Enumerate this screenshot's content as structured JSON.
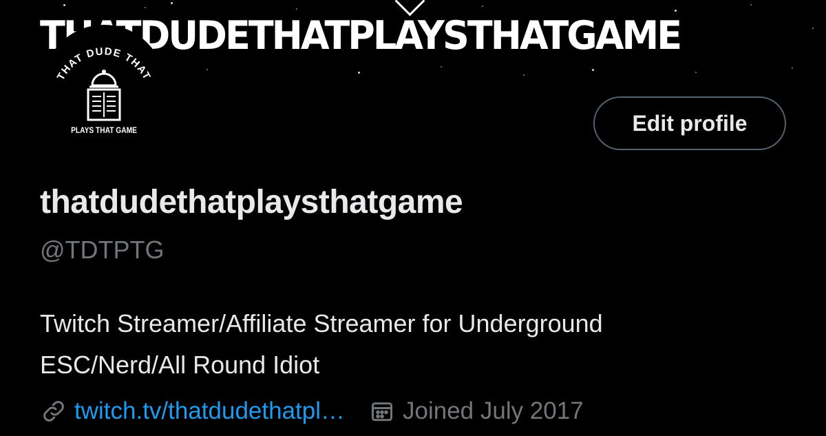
{
  "banner": {
    "title": "THATDUDETHATPLAYSTHATGAME"
  },
  "avatar": {
    "top_text": "THAT DUDE THAT",
    "bottom_text": "PLAYS THAT GAME"
  },
  "actions": {
    "edit_profile_label": "Edit profile"
  },
  "profile": {
    "display_name": "thatdudethatplaysthatgame",
    "handle": "@TDTPTG",
    "bio_line1": "Twitch Streamer/Affiliate Streamer for Underground",
    "bio_line2": "ESC/Nerd/All Round Idiot",
    "website": "twitch.tv/thatdudethatpl…",
    "joined": "Joined July 2017"
  },
  "icons": {
    "link": "link-icon",
    "calendar": "calendar-icon"
  },
  "colors": {
    "background": "#000000",
    "text_primary": "#e7e9ea",
    "text_secondary": "#71767b",
    "link": "#1d9bf0",
    "button_border": "#536471"
  }
}
